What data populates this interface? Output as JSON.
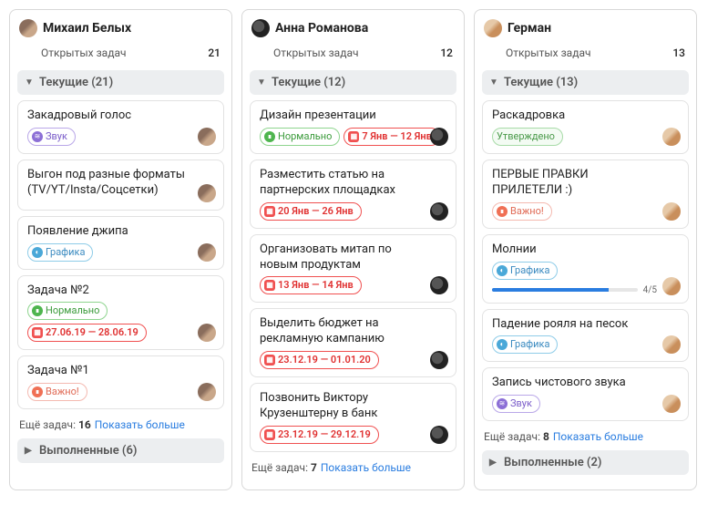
{
  "labels": {
    "open_tasks": "Открытых задач",
    "more_tasks_prefix": "Ещё задач:",
    "show_more": "Показать больше"
  },
  "columns": [
    {
      "id": "mikhail",
      "name": "Михаил Белых",
      "avatar_class": "mikhail",
      "open_count": "21",
      "sections": [
        {
          "id": "current",
          "title": "Текущие (21)",
          "expanded": true,
          "cards": [
            {
              "title": "Закадровый голос",
              "assignee": "mikhail",
              "tags": [
                {
                  "type": "sound",
                  "label": "Звук"
                }
              ]
            },
            {
              "title": "Выгон под разные форматы (TV/YT/Insta/Соцсетки)",
              "assignee": "mikhail",
              "tags": []
            },
            {
              "title": "Появление джипа",
              "assignee": "mikhail",
              "tags": [
                {
                  "type": "graphics",
                  "label": "Графика"
                }
              ]
            },
            {
              "title": "Задача №2",
              "assignee": "mikhail",
              "tags": [
                {
                  "type": "normal",
                  "label": "Нормально"
                },
                {
                  "type": "date",
                  "label": "27.06.19 — 28.06.19"
                }
              ]
            },
            {
              "title": "Задача №1",
              "assignee": "mikhail",
              "tags": [
                {
                  "type": "important",
                  "label": "Важно!"
                }
              ]
            }
          ],
          "more_count": "16"
        },
        {
          "id": "done",
          "title": "Выполненные (6)",
          "expanded": false
        }
      ]
    },
    {
      "id": "anna",
      "name": "Анна Романова",
      "avatar_class": "anna",
      "open_count": "12",
      "sections": [
        {
          "id": "current",
          "title": "Текущие (12)",
          "expanded": true,
          "cards": [
            {
              "title": "Дизайн презентации",
              "assignee": "anna",
              "tags": [
                {
                  "type": "normal",
                  "label": "Нормально"
                },
                {
                  "type": "date",
                  "label": "7 Янв — 12 Янв"
                }
              ]
            },
            {
              "title": "Разместить статью на партнерских площадках",
              "assignee": "anna",
              "tags": [
                {
                  "type": "date",
                  "label": "20 Янв — 26 Янв"
                }
              ]
            },
            {
              "title": "Организовать митап по новым продуктам",
              "assignee": "anna",
              "tags": [
                {
                  "type": "date",
                  "label": "13 Янв — 14 Янв"
                }
              ]
            },
            {
              "title": "Выделить бюджет на рекламную кампанию",
              "assignee": "anna",
              "tags": [
                {
                  "type": "date",
                  "label": "23.12.19 — 01.01.20"
                }
              ]
            },
            {
              "title": "Позвонить Виктору Крузенштерну в банк",
              "assignee": "anna",
              "tags": [
                {
                  "type": "date",
                  "label": "23.12.19 — 29.12.19"
                }
              ]
            }
          ],
          "more_count": "7"
        }
      ]
    },
    {
      "id": "german",
      "name": "Герман",
      "avatar_class": "german",
      "open_count": "13",
      "sections": [
        {
          "id": "current",
          "title": "Текущие (13)",
          "expanded": true,
          "cards": [
            {
              "title": "Раскадровка",
              "assignee": "german",
              "tags": [
                {
                  "type": "approved",
                  "label": "Утверждено"
                }
              ]
            },
            {
              "title": "ПЕРВЫЕ ПРАВКИ ПРИЛЕТЕЛИ :)",
              "assignee": "german",
              "tags": [
                {
                  "type": "important",
                  "label": "Важно!"
                }
              ]
            },
            {
              "title": "Молнии",
              "assignee": "german",
              "tags": [
                {
                  "type": "graphics",
                  "label": "Графика"
                }
              ],
              "progress": {
                "done": 4,
                "total": 5,
                "label": "4/5"
              }
            },
            {
              "title": "Падение рояля на песок",
              "assignee": "german",
              "tags": [
                {
                  "type": "graphics",
                  "label": "Графика"
                }
              ]
            },
            {
              "title": "Запись чистового звука",
              "assignee": "german",
              "tags": [
                {
                  "type": "sound",
                  "label": "Звук"
                }
              ]
            }
          ],
          "more_count": "8"
        },
        {
          "id": "done",
          "title": "Выполненные (2)",
          "expanded": false
        }
      ]
    }
  ]
}
